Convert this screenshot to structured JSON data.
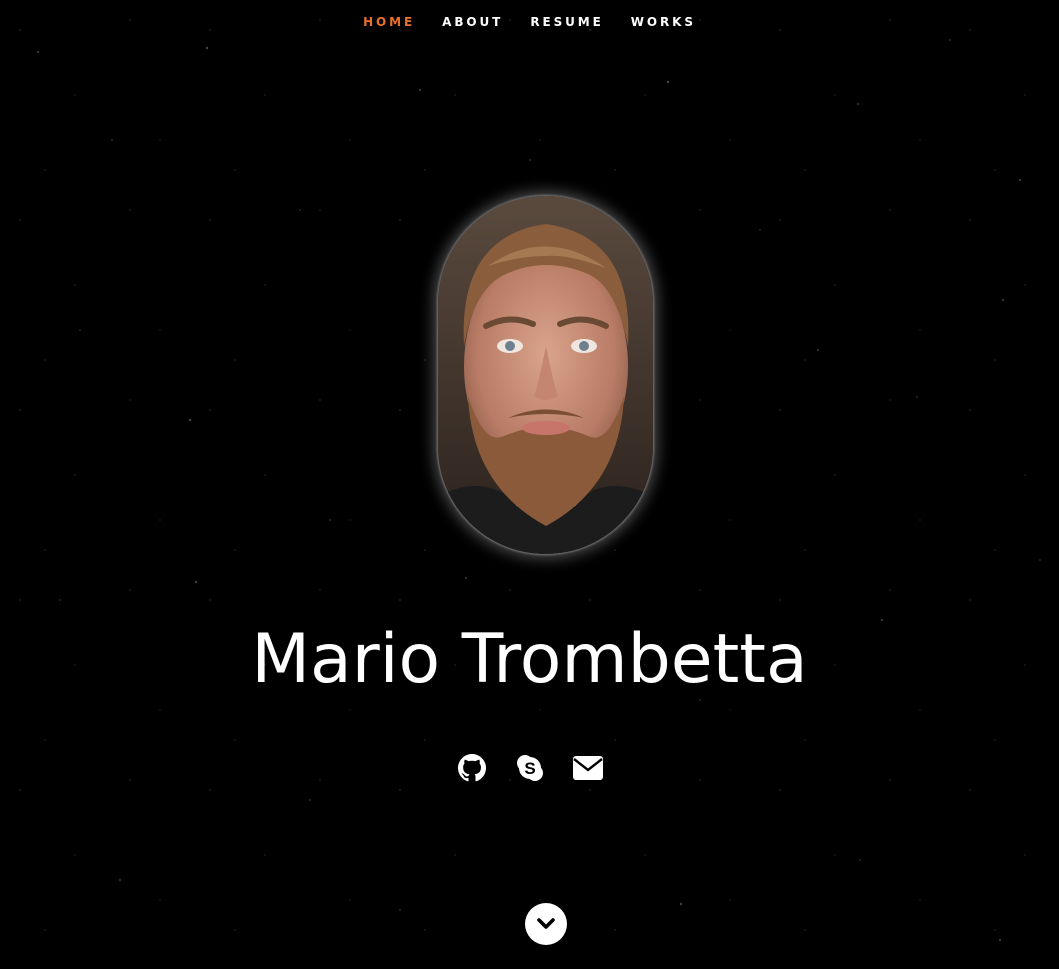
{
  "nav": {
    "items": [
      {
        "label": "HOME",
        "active": true
      },
      {
        "label": "ABOUT",
        "active": false
      },
      {
        "label": "RESUME",
        "active": false
      },
      {
        "label": "WORKS",
        "active": false
      }
    ],
    "active_color": "#e8702a"
  },
  "hero": {
    "name": "Mario Trombetta",
    "portrait": "profile-photo"
  },
  "socials": [
    {
      "icon": "github-icon"
    },
    {
      "icon": "skype-icon"
    },
    {
      "icon": "envelope-icon"
    }
  ],
  "scroll_button": {
    "icon": "chevron-down-icon"
  },
  "colors": {
    "background": "#000000",
    "text": "#ffffff",
    "accent": "#e8702a"
  }
}
